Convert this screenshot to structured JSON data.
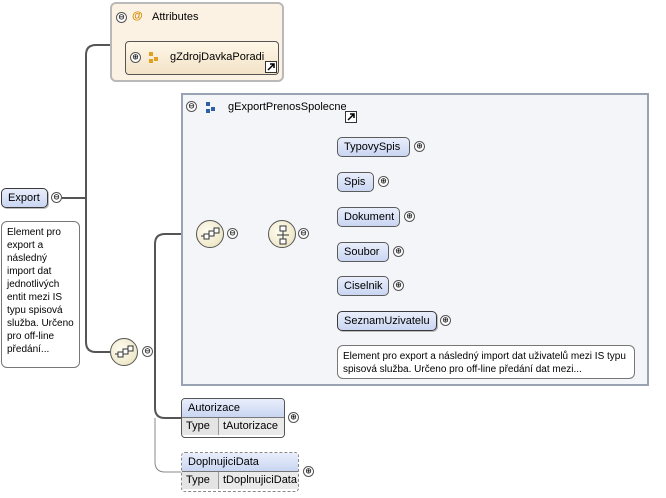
{
  "root": {
    "label": "Export",
    "doc": "Element pro export a následný import dat jednotlivých entit mezi IS typu spisová služba. Určeno pro off-line předání..."
  },
  "attributes": {
    "title": "Attributes",
    "at_symbol": "@",
    "group_ref": "gZdrojDavkaPoradi"
  },
  "export_group": {
    "name": "gExportPrenosSpolecne"
  },
  "children": [
    {
      "label": "TypovySpis"
    },
    {
      "label": "Spis"
    },
    {
      "label": "Dokument"
    },
    {
      "label": "Soubor"
    },
    {
      "label": "Ciselnik"
    },
    {
      "label": "SeznamUzivatelu"
    }
  ],
  "seznam_doc": "Element pro export a následný import dat uživatelů mezi IS typu spisová služba. Určeno pro off-line předání dat mezi...",
  "autorizace": {
    "label": "Autorizace",
    "type_key": "Type",
    "type_value": "tAutorizace"
  },
  "doplnujici": {
    "label": "DoplnujiciData",
    "type_key": "Type",
    "type_value": "tDoplnujiciData"
  },
  "symbols": {
    "collapse": "⊖",
    "expand": "⊕"
  },
  "colors": {
    "line": "#5a5a5a",
    "node_fill": "#d6e0f5",
    "attr_fill": "#fbf2e4",
    "group_border": "#9aa3b3"
  }
}
